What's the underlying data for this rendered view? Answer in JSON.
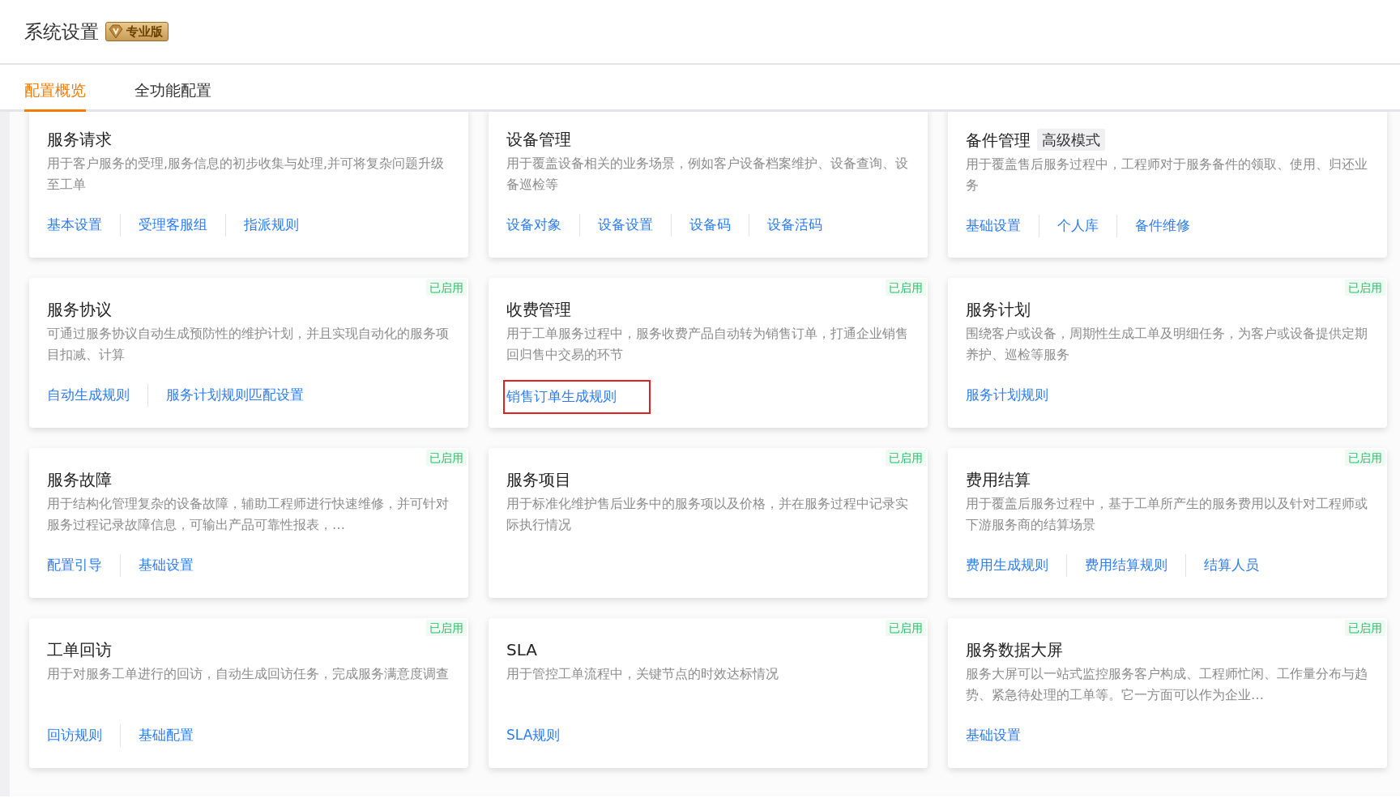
{
  "header": {
    "title": "系统设置",
    "edition": "专业版"
  },
  "tabs": [
    {
      "label": "配置概览",
      "selected": true
    },
    {
      "label": "全功能配置",
      "selected": false
    }
  ],
  "cards": [
    {
      "title": "服务请求",
      "description": "用于客户服务的受理,服务信息的初步收集与处理,并可将复杂问题升级至工单",
      "links": [
        {
          "label": "基本设置",
          "highlighted": false
        },
        {
          "label": "受理客服组",
          "highlighted": false
        },
        {
          "label": "指派规则",
          "highlighted": false
        }
      ]
    },
    {
      "title": "设备管理",
      "description": "用于覆盖设备相关的业务场景，例如客户设备档案维护、设备查询、设备巡检等",
      "links": [
        {
          "label": "设备对象",
          "highlighted": false
        },
        {
          "label": "设备设置",
          "highlighted": false
        },
        {
          "label": "设备码",
          "highlighted": false
        },
        {
          "label": "设备活码",
          "highlighted": false
        }
      ]
    },
    {
      "title": "备件管理",
      "tag": "高级模式",
      "description": "用于覆盖售后服务过程中，工程师对于服务备件的领取、使用、归还业务",
      "links": [
        {
          "label": "基础设置",
          "highlighted": false
        },
        {
          "label": "个人库",
          "highlighted": false
        },
        {
          "label": "备件维修",
          "highlighted": false
        }
      ]
    },
    {
      "status": "已启用",
      "title": "服务协议",
      "description": "可通过服务协议自动生成预防性的维护计划，并且实现自动化的服务项目扣减、计算",
      "links": [
        {
          "label": "自动生成规则",
          "highlighted": false
        },
        {
          "label": "服务计划规则匹配设置",
          "highlighted": false
        }
      ]
    },
    {
      "status": "已启用",
      "title": "收费管理",
      "description": "用于工单服务过程中，服务收费产品自动转为销售订单，打通企业销售回归售中交易的环节",
      "links": [
        {
          "label": "销售订单生成规则",
          "highlighted": true
        }
      ]
    },
    {
      "status": "已启用",
      "title": "服务计划",
      "description": "围绕客户或设备，周期性生成工单及明细任务，为客户或设备提供定期养护、巡检等服务",
      "links": [
        {
          "label": "服务计划规则",
          "highlighted": false
        }
      ]
    },
    {
      "status": "已启用",
      "title": "服务故障",
      "description": "用于结构化管理复杂的设备故障，辅助工程师进行快速维修，并可针对服务过程记录故障信息，可输出产品可靠性报表，…",
      "links": [
        {
          "label": "配置引导",
          "highlighted": false
        },
        {
          "label": "基础设置",
          "highlighted": false
        }
      ]
    },
    {
      "status": "已启用",
      "title": "服务项目",
      "description": "用于标准化维护售后业务中的服务项以及价格，并在服务过程中记录实际执行情况"
    },
    {
      "status": "已启用",
      "title": "费用结算",
      "description": "用于覆盖后服务过程中，基于工单所产生的服务费用以及针对工程师或下游服务商的结算场景",
      "links": [
        {
          "label": "费用生成规则",
          "highlighted": false
        },
        {
          "label": "费用结算规则",
          "highlighted": false
        },
        {
          "label": "结算人员",
          "highlighted": false
        }
      ]
    },
    {
      "status": "已启用",
      "title": "工单回访",
      "description": "用于对服务工单进行的回访，自动生成回访任务，完成服务满意度调查",
      "links": [
        {
          "label": "回访规则",
          "highlighted": false
        },
        {
          "label": "基础配置",
          "highlighted": false
        }
      ]
    },
    {
      "status": "已启用",
      "title": "SLA",
      "description": "用于管控工单流程中，关键节点的时效达标情况",
      "links": [
        {
          "label": "SLA规则",
          "highlighted": false
        }
      ]
    },
    {
      "status": "已启用",
      "title": "服务数据大屏",
      "description": "服务大屏可以一站式监控服务客户构成、工程师忙闲、工作量分布与趋势、紧急待处理的工单等。它一方面可以作为企业…",
      "links": [
        {
          "label": "基础设置",
          "highlighted": false
        }
      ]
    }
  ]
}
